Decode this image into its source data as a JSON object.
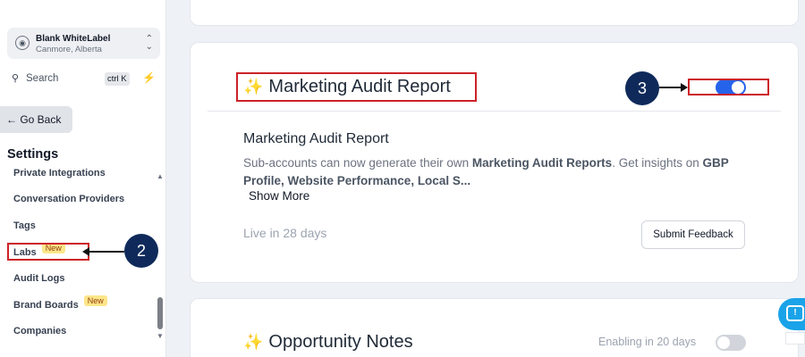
{
  "sidebar": {
    "account": {
      "name": "Blank WhiteLabel",
      "location": "Canmore, Alberta"
    },
    "search": {
      "label": "Search",
      "shortcut": "ctrl K"
    },
    "back_label": "← Go Back",
    "settings_title": "Settings",
    "items": [
      {
        "label": "Private Integrations"
      },
      {
        "label": "Conversation Providers"
      },
      {
        "label": "Tags"
      },
      {
        "label": "Labs",
        "badge": "New"
      },
      {
        "label": "Audit Logs"
      },
      {
        "label": "Brand Boards",
        "badge": "New"
      },
      {
        "label": "Companies"
      }
    ]
  },
  "annotations": {
    "marker_2": "2",
    "marker_3": "3"
  },
  "main": {
    "feature_card": {
      "title": "Marketing Audit Report",
      "subtitle": "Marketing Audit Report",
      "desc_part1": "Sub-accounts can now generate their own ",
      "desc_bold1": "Marketing Audit Reports",
      "desc_part2": ". Get insights on ",
      "desc_bold2": "GBP Profile, Website Performance, Local S...",
      "show_more": "Show More",
      "live_in": "Live in 28 days",
      "feedback_label": "Submit Feedback",
      "toggle_on": true
    },
    "next_card": {
      "title": "Opportunity Notes",
      "enabling_text": "Enabling in 20 days",
      "toggle_on": false
    }
  },
  "colors": {
    "accent": "#2563eb",
    "annotation_red": "#cc2127",
    "marker_navy": "#0f2a5a",
    "badge_bg": "#fde68a"
  }
}
